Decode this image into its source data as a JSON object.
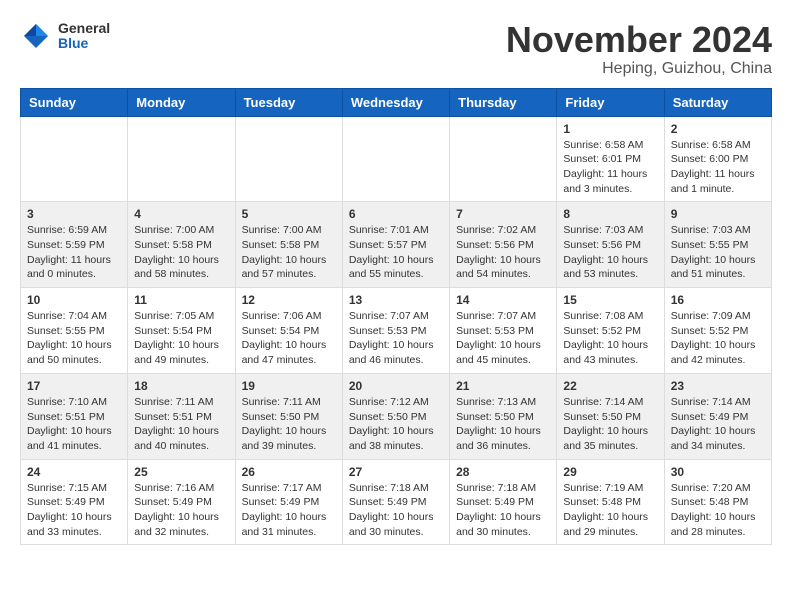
{
  "header": {
    "logo_general": "General",
    "logo_blue": "Blue",
    "month_title": "November 2024",
    "subtitle": "Heping, Guizhou, China"
  },
  "weekdays": [
    "Sunday",
    "Monday",
    "Tuesday",
    "Wednesday",
    "Thursday",
    "Friday",
    "Saturday"
  ],
  "weeks": [
    {
      "days": [
        {
          "num": "",
          "info": ""
        },
        {
          "num": "",
          "info": ""
        },
        {
          "num": "",
          "info": ""
        },
        {
          "num": "",
          "info": ""
        },
        {
          "num": "",
          "info": ""
        },
        {
          "num": "1",
          "info": "Sunrise: 6:58 AM\nSunset: 6:01 PM\nDaylight: 11 hours\nand 3 minutes."
        },
        {
          "num": "2",
          "info": "Sunrise: 6:58 AM\nSunset: 6:00 PM\nDaylight: 11 hours\nand 1 minute."
        }
      ]
    },
    {
      "days": [
        {
          "num": "3",
          "info": "Sunrise: 6:59 AM\nSunset: 5:59 PM\nDaylight: 11 hours\nand 0 minutes."
        },
        {
          "num": "4",
          "info": "Sunrise: 7:00 AM\nSunset: 5:58 PM\nDaylight: 10 hours\nand 58 minutes."
        },
        {
          "num": "5",
          "info": "Sunrise: 7:00 AM\nSunset: 5:58 PM\nDaylight: 10 hours\nand 57 minutes."
        },
        {
          "num": "6",
          "info": "Sunrise: 7:01 AM\nSunset: 5:57 PM\nDaylight: 10 hours\nand 55 minutes."
        },
        {
          "num": "7",
          "info": "Sunrise: 7:02 AM\nSunset: 5:56 PM\nDaylight: 10 hours\nand 54 minutes."
        },
        {
          "num": "8",
          "info": "Sunrise: 7:03 AM\nSunset: 5:56 PM\nDaylight: 10 hours\nand 53 minutes."
        },
        {
          "num": "9",
          "info": "Sunrise: 7:03 AM\nSunset: 5:55 PM\nDaylight: 10 hours\nand 51 minutes."
        }
      ]
    },
    {
      "days": [
        {
          "num": "10",
          "info": "Sunrise: 7:04 AM\nSunset: 5:55 PM\nDaylight: 10 hours\nand 50 minutes."
        },
        {
          "num": "11",
          "info": "Sunrise: 7:05 AM\nSunset: 5:54 PM\nDaylight: 10 hours\nand 49 minutes."
        },
        {
          "num": "12",
          "info": "Sunrise: 7:06 AM\nSunset: 5:54 PM\nDaylight: 10 hours\nand 47 minutes."
        },
        {
          "num": "13",
          "info": "Sunrise: 7:07 AM\nSunset: 5:53 PM\nDaylight: 10 hours\nand 46 minutes."
        },
        {
          "num": "14",
          "info": "Sunrise: 7:07 AM\nSunset: 5:53 PM\nDaylight: 10 hours\nand 45 minutes."
        },
        {
          "num": "15",
          "info": "Sunrise: 7:08 AM\nSunset: 5:52 PM\nDaylight: 10 hours\nand 43 minutes."
        },
        {
          "num": "16",
          "info": "Sunrise: 7:09 AM\nSunset: 5:52 PM\nDaylight: 10 hours\nand 42 minutes."
        }
      ]
    },
    {
      "days": [
        {
          "num": "17",
          "info": "Sunrise: 7:10 AM\nSunset: 5:51 PM\nDaylight: 10 hours\nand 41 minutes."
        },
        {
          "num": "18",
          "info": "Sunrise: 7:11 AM\nSunset: 5:51 PM\nDaylight: 10 hours\nand 40 minutes."
        },
        {
          "num": "19",
          "info": "Sunrise: 7:11 AM\nSunset: 5:50 PM\nDaylight: 10 hours\nand 39 minutes."
        },
        {
          "num": "20",
          "info": "Sunrise: 7:12 AM\nSunset: 5:50 PM\nDaylight: 10 hours\nand 38 minutes."
        },
        {
          "num": "21",
          "info": "Sunrise: 7:13 AM\nSunset: 5:50 PM\nDaylight: 10 hours\nand 36 minutes."
        },
        {
          "num": "22",
          "info": "Sunrise: 7:14 AM\nSunset: 5:50 PM\nDaylight: 10 hours\nand 35 minutes."
        },
        {
          "num": "23",
          "info": "Sunrise: 7:14 AM\nSunset: 5:49 PM\nDaylight: 10 hours\nand 34 minutes."
        }
      ]
    },
    {
      "days": [
        {
          "num": "24",
          "info": "Sunrise: 7:15 AM\nSunset: 5:49 PM\nDaylight: 10 hours\nand 33 minutes."
        },
        {
          "num": "25",
          "info": "Sunrise: 7:16 AM\nSunset: 5:49 PM\nDaylight: 10 hours\nand 32 minutes."
        },
        {
          "num": "26",
          "info": "Sunrise: 7:17 AM\nSunset: 5:49 PM\nDaylight: 10 hours\nand 31 minutes."
        },
        {
          "num": "27",
          "info": "Sunrise: 7:18 AM\nSunset: 5:49 PM\nDaylight: 10 hours\nand 30 minutes."
        },
        {
          "num": "28",
          "info": "Sunrise: 7:18 AM\nSunset: 5:49 PM\nDaylight: 10 hours\nand 30 minutes."
        },
        {
          "num": "29",
          "info": "Sunrise: 7:19 AM\nSunset: 5:48 PM\nDaylight: 10 hours\nand 29 minutes."
        },
        {
          "num": "30",
          "info": "Sunrise: 7:20 AM\nSunset: 5:48 PM\nDaylight: 10 hours\nand 28 minutes."
        }
      ]
    }
  ]
}
